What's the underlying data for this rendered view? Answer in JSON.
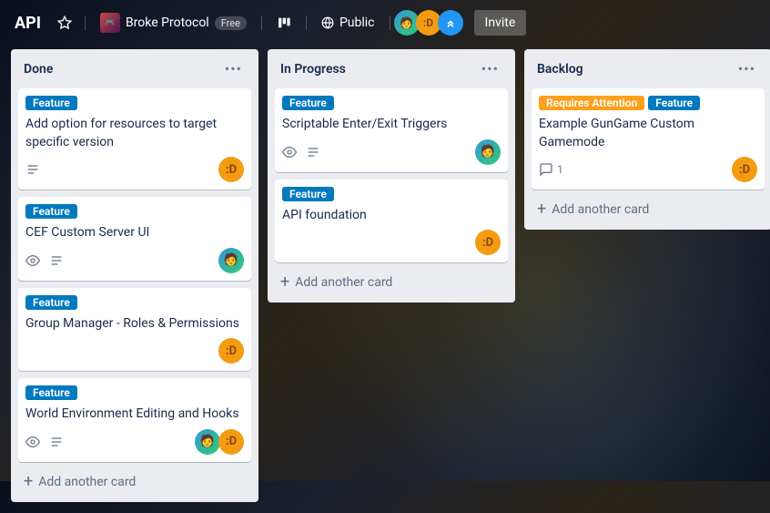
{
  "header": {
    "board_title": "API",
    "workspace_name": "Broke Protocol",
    "free_label": "Free",
    "visibility_label": "Public",
    "invite_label": "Invite"
  },
  "labels": {
    "feature": "Feature",
    "requires_attention": "Requires Attention"
  },
  "lists": {
    "done": {
      "title": "Done",
      "add": "Add another card",
      "cards": [
        {
          "title": "Add option for resources to target specific version"
        },
        {
          "title": "CEF Custom Server UI"
        },
        {
          "title": "Group Manager - Roles & Permissions"
        },
        {
          "title": "World Environment Editing and Hooks"
        }
      ]
    },
    "in_progress": {
      "title": "In Progress",
      "add": "Add another card",
      "cards": [
        {
          "title": "Scriptable Enter/Exit Triggers"
        },
        {
          "title": "API foundation"
        }
      ]
    },
    "backlog": {
      "title": "Backlog",
      "add": "Add another card",
      "cards": [
        {
          "title": "Example GunGame Custom Gamemode",
          "comments": "1"
        }
      ]
    }
  }
}
